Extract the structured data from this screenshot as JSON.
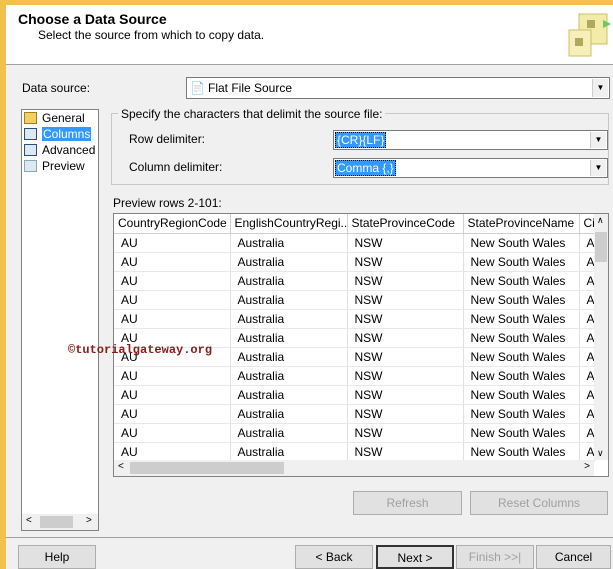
{
  "header": {
    "title": "Choose a Data Source",
    "subtitle": "Select the source from which to copy data."
  },
  "data_source": {
    "label": "Data source:",
    "value": "Flat File Source"
  },
  "nav": {
    "items": [
      {
        "label": "General",
        "icon": "general-icon"
      },
      {
        "label": "Columns",
        "icon": "columns-icon",
        "active": true
      },
      {
        "label": "Advanced",
        "icon": "advanced-icon"
      },
      {
        "label": "Preview",
        "icon": "preview-icon"
      }
    ]
  },
  "delimiters": {
    "group_label": "Specify the characters that delimit the source file:",
    "row_label": "Row delimiter:",
    "row_value": "{CR}{LF}",
    "column_label": "Column delimiter:",
    "column_value": "Comma {,}"
  },
  "preview": {
    "label": "Preview rows 2-101:",
    "columns": [
      "CountryRegionCode",
      "EnglishCountryRegi...",
      "StateProvinceCode",
      "StateProvinceName",
      "Cit"
    ],
    "rows": [
      [
        "AU",
        "Australia",
        "NSW",
        "New South Wales",
        "Al"
      ],
      [
        "AU",
        "Australia",
        "NSW",
        "New South Wales",
        "Al"
      ],
      [
        "AU",
        "Australia",
        "NSW",
        "New South Wales",
        "Al"
      ],
      [
        "AU",
        "Australia",
        "NSW",
        "New South Wales",
        "Al"
      ],
      [
        "AU",
        "Australia",
        "NSW",
        "New South Wales",
        "Al"
      ],
      [
        "AU",
        "Australia",
        "NSW",
        "New South Wales",
        "Al"
      ],
      [
        "AU",
        "Australia",
        "NSW",
        "New South Wales",
        "Al"
      ],
      [
        "AU",
        "Australia",
        "NSW",
        "New South Wales",
        "Al"
      ],
      [
        "AU",
        "Australia",
        "NSW",
        "New South Wales",
        "Al"
      ],
      [
        "AU",
        "Australia",
        "NSW",
        "New South Wales",
        "Al"
      ],
      [
        "AU",
        "Australia",
        "NSW",
        "New South Wales",
        "Al"
      ],
      [
        "AU",
        "Australia",
        "NSW",
        "New South Wales",
        "Al"
      ]
    ]
  },
  "buttons": {
    "refresh": "Refresh",
    "reset": "Reset Columns",
    "help": "Help",
    "back": "< Back",
    "next": "Next >",
    "finish": "Finish >>|",
    "cancel": "Cancel"
  },
  "watermark": "©tutorialgateway.org"
}
